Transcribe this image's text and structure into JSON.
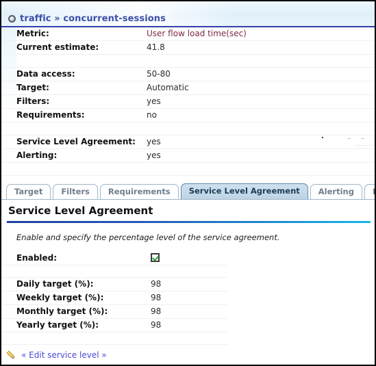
{
  "window": {
    "border_color": "#000000",
    "background": "#ffffff"
  },
  "header": {
    "icon": "circle-bullet-icon",
    "breadcrumb": "traffic » concurrent-sessions",
    "accent_color": "#3b4fa8",
    "underline_color": "#3340a8"
  },
  "summary": {
    "rows": [
      {
        "label": "Metric:",
        "value": "User flow load time(sec)",
        "value_color": "#7a2b45"
      },
      {
        "label": "Current estimate:",
        "value": "41.8",
        "value_color": "#2b2b2b"
      },
      {
        "label": "Data access:",
        "value": "50-80",
        "value_color": "#2b2b2b"
      },
      {
        "label": "Target:",
        "value": "Automatic",
        "value_color": "#2b2b2b"
      },
      {
        "label": "Filters:",
        "value": "yes",
        "value_color": "#2b2b2b"
      },
      {
        "label": "Requirements:",
        "value": "no",
        "value_color": "#2b2b2b"
      },
      {
        "label": "Service Level Agreement:",
        "value": "yes",
        "value_color": "#2b2b2b"
      },
      {
        "label": "Alerting:",
        "value": "yes",
        "value_color": "#2b2b2b"
      }
    ]
  },
  "tabs": {
    "items": [
      {
        "label": "Target",
        "active": false
      },
      {
        "label": "Filters",
        "active": false
      },
      {
        "label": "Requirements",
        "active": false
      },
      {
        "label": "Service Level Agreement",
        "active": true
      },
      {
        "label": "Alerting",
        "active": false
      },
      {
        "label": "Description",
        "active": false
      }
    ],
    "active_bg": "#c5daea",
    "inactive_text": "#6e7f8e"
  },
  "panel": {
    "title": "Service Level Agreement",
    "rule_gradient_from": "#1f3fa0",
    "rule_gradient_to": "#17b6e8",
    "description": "Enable and specify the percentage level of the service agreement.",
    "enabled_label": "Enabled:",
    "enabled_checked": true,
    "checkbox_check_color": "#2f9e31",
    "targets": [
      {
        "label": "Daily target (%):",
        "value": "98"
      },
      {
        "label": "Weekly target (%):",
        "value": "98"
      },
      {
        "label": "Monthly target (%):",
        "value": "98"
      },
      {
        "label": "Yearly target (%):",
        "value": "98"
      }
    ]
  },
  "footer": {
    "icon": "pencil-icon",
    "edit_link": "« Edit service level »",
    "link_color": "#4848d8"
  }
}
